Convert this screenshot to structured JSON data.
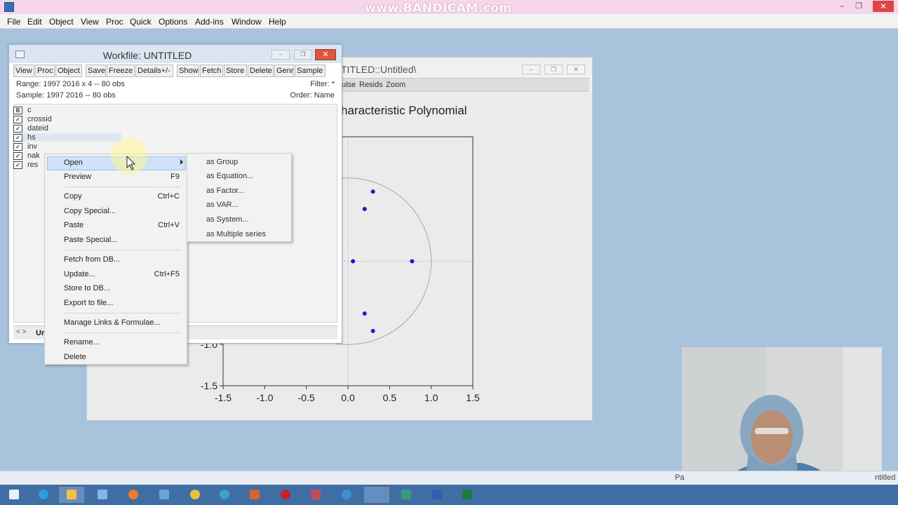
{
  "window": {
    "watermark": "www.BANDICAM.com"
  },
  "menubar": [
    "File",
    "Edit",
    "Object",
    "View",
    "Proc",
    "Quick",
    "Options",
    "Add-ins",
    "Window",
    "Help"
  ],
  "graph_window": {
    "title": "TITLED::Untitled\\",
    "toolbar": [
      "ulse",
      "Resids",
      "Zoom"
    ],
    "chart_title": "haracteristic Polynomial"
  },
  "workfile": {
    "title": "Workfile: UNTITLED",
    "toolbar": [
      "View",
      "Proc",
      "Object",
      "Save",
      "Freeze",
      "Details+/-",
      "Show",
      "Fetch",
      "Store",
      "Delete",
      "Genr",
      "Sample"
    ],
    "range": "Range:  1997 2016 x 4   --   80 obs",
    "sample": "Sample: 1997 2016   --   80 obs",
    "filter": "Filter: *",
    "order": "Order: Name",
    "objects": [
      {
        "name": "c",
        "icon": "B"
      },
      {
        "name": "crossid",
        "icon": "check"
      },
      {
        "name": "dateid",
        "icon": "check"
      },
      {
        "name": "hs",
        "icon": "check"
      },
      {
        "name": "inv",
        "icon": "check"
      },
      {
        "name": "nak",
        "icon": "check"
      },
      {
        "name": "res",
        "icon": "check"
      }
    ],
    "tab_label": "Ur"
  },
  "context_menu": {
    "items": [
      {
        "label": "Open",
        "shortcut": ""
      },
      {
        "label": "Preview",
        "shortcut": "F9"
      },
      {
        "label": "Copy",
        "shortcut": "Ctrl+C"
      },
      {
        "label": "Copy Special...",
        "shortcut": ""
      },
      {
        "label": "Paste",
        "shortcut": "Ctrl+V"
      },
      {
        "label": "Paste Special...",
        "shortcut": ""
      },
      {
        "label": "Fetch from DB...",
        "shortcut": ""
      },
      {
        "label": "Update...",
        "shortcut": "Ctrl+F5"
      },
      {
        "label": "Store to DB...",
        "shortcut": ""
      },
      {
        "label": "Export to file...",
        "shortcut": ""
      },
      {
        "label": "Manage Links & Formulae...",
        "shortcut": ""
      },
      {
        "label": "Rename...",
        "shortcut": ""
      },
      {
        "label": "Delete",
        "shortcut": ""
      }
    ]
  },
  "submenu": [
    "as Group",
    "as Equation...",
    "as Factor...",
    "as VAR...",
    "as System...",
    "as Multiple series"
  ],
  "statusbar": {
    "left": "Pa",
    "right": "ntitled"
  },
  "chart_data": {
    "type": "scatter",
    "title": "haracteristic Polynomial",
    "x_ticks": [
      "-1.5",
      "-1.0",
      "-0.5",
      "0.0",
      "0.5",
      "1.0",
      "1.5"
    ],
    "y_ticks": [
      "-1.5",
      "-1.0"
    ],
    "xlim": [
      -1.5,
      1.5
    ],
    "ylim": [
      -1.5,
      1.5
    ],
    "unit_circle": true,
    "points": [
      {
        "x": 0.77,
        "y": 0.0
      },
      {
        "x": 0.06,
        "y": 0.0
      },
      {
        "x": 0.3,
        "y": 0.84
      },
      {
        "x": 0.3,
        "y": -0.84
      },
      {
        "x": 0.2,
        "y": 0.63
      },
      {
        "x": 0.2,
        "y": -0.63
      }
    ],
    "point_color": "#1a1ad0"
  }
}
